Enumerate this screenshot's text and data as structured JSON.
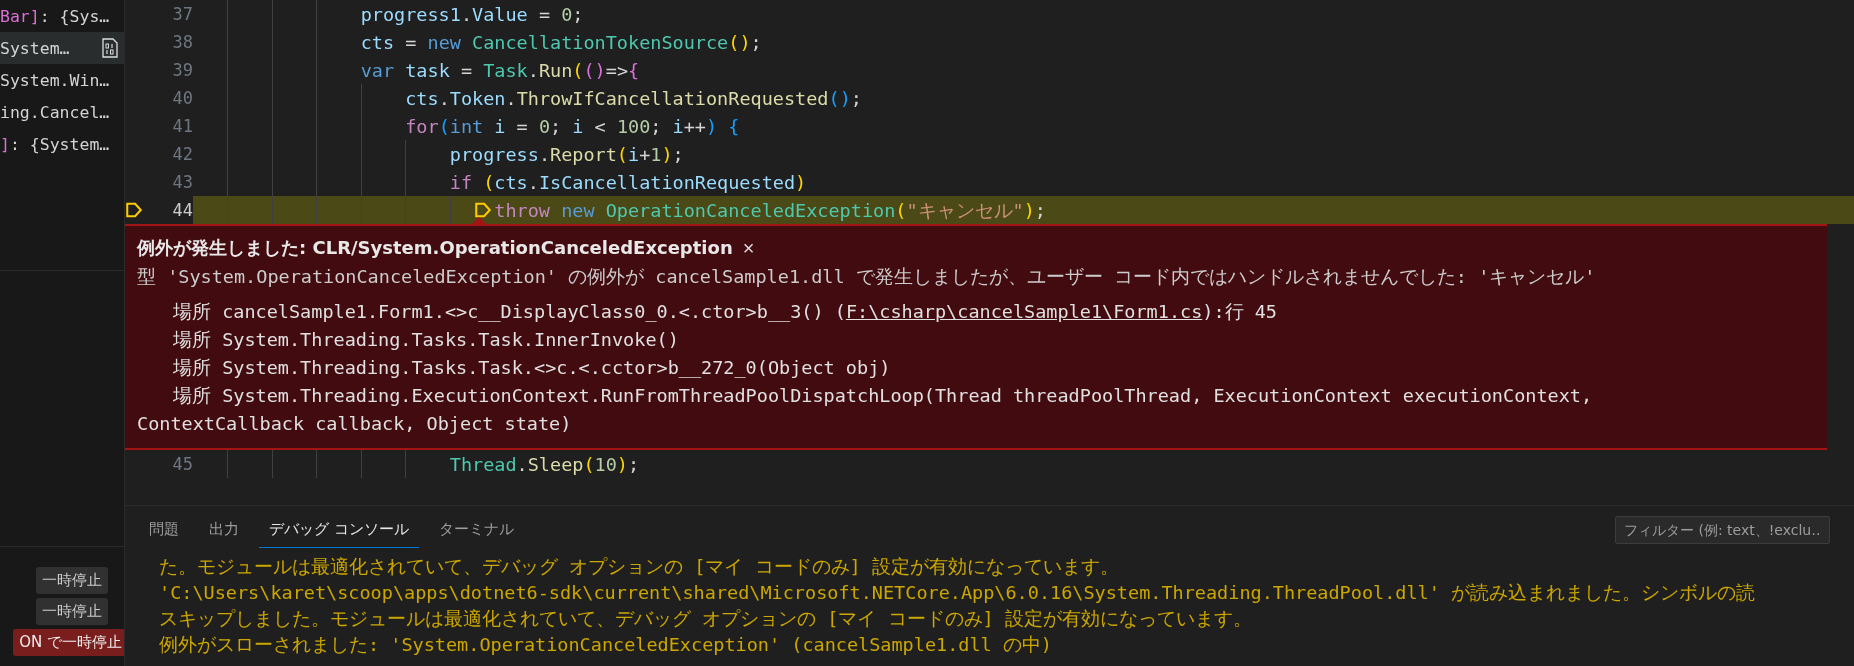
{
  "sidebar": {
    "variables": [
      {
        "parts": [
          {
            "kind": "bracket2",
            "t": "Bar]"
          },
          {
            "kind": "plain",
            "t": ": {Sys…"
          }
        ],
        "selected": false,
        "binary_icon": false
      },
      {
        "parts": [
          {
            "kind": "plain",
            "t": "System…"
          }
        ],
        "selected": true,
        "binary_icon": true
      },
      {
        "parts": [
          {
            "kind": "plain",
            "t": "System.Win…"
          }
        ],
        "selected": false,
        "binary_icon": false
      },
      {
        "parts": [
          {
            "kind": "plain",
            "t": "ing.Cancel…"
          }
        ],
        "selected": false,
        "binary_icon": false
      },
      {
        "parts": [
          {
            "kind": "bracket2",
            "t": "]"
          },
          {
            "kind": "plain",
            "t": ": {System…"
          }
        ],
        "selected": false,
        "binary_icon": false
      }
    ],
    "breakpoint_buttons": [
      {
        "label": "一時停止",
        "kind": "plain"
      },
      {
        "label": "一時停止",
        "kind": "plain"
      },
      {
        "label": "ON で一時停止",
        "kind": "alert"
      }
    ]
  },
  "editor": {
    "lines": [
      {
        "number": "37",
        "current": false,
        "tokens": [
          {
            "kind": "variable",
            "t": "            progress1"
          },
          {
            "kind": "plain",
            "t": "."
          },
          {
            "kind": "variable",
            "t": "Value"
          },
          {
            "kind": "plain",
            "t": " = "
          },
          {
            "kind": "number",
            "t": "0"
          },
          {
            "kind": "plain",
            "t": ";"
          }
        ]
      },
      {
        "number": "38",
        "current": false,
        "tokens": [
          {
            "kind": "variable",
            "t": "            cts"
          },
          {
            "kind": "plain",
            "t": " = "
          },
          {
            "kind": "keyword",
            "t": "new "
          },
          {
            "kind": "type",
            "t": "CancellationTokenSource"
          },
          {
            "kind": "bracket1",
            "t": "()"
          },
          {
            "kind": "plain",
            "t": ";"
          }
        ]
      },
      {
        "number": "39",
        "current": false,
        "tokens": [
          {
            "kind": "keyword",
            "t": "            var "
          },
          {
            "kind": "variable",
            "t": "task"
          },
          {
            "kind": "plain",
            "t": " = "
          },
          {
            "kind": "type",
            "t": "Task"
          },
          {
            "kind": "plain",
            "t": "."
          },
          {
            "kind": "function",
            "t": "Run"
          },
          {
            "kind": "bracket1",
            "t": "("
          },
          {
            "kind": "bracket2",
            "t": "()"
          },
          {
            "kind": "plain",
            "t": "=>"
          },
          {
            "kind": "bracket2",
            "t": "{"
          }
        ]
      },
      {
        "number": "40",
        "current": false,
        "tokens": [
          {
            "kind": "variable",
            "t": "                cts"
          },
          {
            "kind": "plain",
            "t": "."
          },
          {
            "kind": "variable",
            "t": "Token"
          },
          {
            "kind": "plain",
            "t": "."
          },
          {
            "kind": "function",
            "t": "ThrowIfCancellationRequested"
          },
          {
            "kind": "bracket3",
            "t": "()"
          },
          {
            "kind": "plain",
            "t": ";"
          }
        ]
      },
      {
        "number": "41",
        "current": false,
        "tokens": [
          {
            "kind": "control",
            "t": "                for"
          },
          {
            "kind": "bracket3",
            "t": "("
          },
          {
            "kind": "keyword",
            "t": "int "
          },
          {
            "kind": "variable",
            "t": "i"
          },
          {
            "kind": "plain",
            "t": " = "
          },
          {
            "kind": "number",
            "t": "0"
          },
          {
            "kind": "plain",
            "t": "; "
          },
          {
            "kind": "variable",
            "t": "i"
          },
          {
            "kind": "plain",
            "t": " < "
          },
          {
            "kind": "number",
            "t": "100"
          },
          {
            "kind": "plain",
            "t": "; "
          },
          {
            "kind": "variable",
            "t": "i"
          },
          {
            "kind": "plain",
            "t": "++"
          },
          {
            "kind": "bracket3",
            "t": ")"
          },
          {
            "kind": "bracket3",
            "t": " {"
          }
        ]
      },
      {
        "number": "42",
        "current": false,
        "tokens": [
          {
            "kind": "variable",
            "t": "                    progress"
          },
          {
            "kind": "plain",
            "t": "."
          },
          {
            "kind": "function",
            "t": "Report"
          },
          {
            "kind": "bracket1",
            "t": "("
          },
          {
            "kind": "variable",
            "t": "i"
          },
          {
            "kind": "plain",
            "t": "+"
          },
          {
            "kind": "number",
            "t": "1"
          },
          {
            "kind": "bracket1",
            "t": ")"
          },
          {
            "kind": "plain",
            "t": ";"
          }
        ]
      },
      {
        "number": "43",
        "current": false,
        "tokens": [
          {
            "kind": "control",
            "t": "                    if"
          },
          {
            "kind": "bracket1",
            "t": " ("
          },
          {
            "kind": "variable",
            "t": "cts"
          },
          {
            "kind": "plain",
            "t": "."
          },
          {
            "kind": "variable",
            "t": "IsCancellationRequested"
          },
          {
            "kind": "bracket1",
            "t": ")"
          }
        ]
      },
      {
        "number": "44",
        "current": true,
        "tokens": [
          {
            "kind": "control",
            "t": "                        throw "
          },
          {
            "kind": "keyword",
            "t": "new "
          },
          {
            "kind": "type",
            "t": "OperationCanceledException"
          },
          {
            "kind": "bracket1",
            "t": "("
          },
          {
            "kind": "string",
            "t": "\"キャンセル\""
          },
          {
            "kind": "bracket1",
            "t": ")"
          },
          {
            "kind": "plain",
            "t": ";"
          }
        ]
      }
    ],
    "exception": {
      "title": "例外が発生しました: CLR/System.OperationCanceledException",
      "close": "×",
      "message": "型 'System.OperationCanceledException' の例外が cancelSample1.dll で発生しましたが、ユーザー コード内ではハンドルされませんでした: 'キャンセル'",
      "frames": [
        {
          "label": "場所",
          "text": "cancelSample1.Form1.<>c__DisplayClass0_0.<.ctor>b__3() (",
          "link": "F:\\csharp\\cancelSample1\\Form1.cs",
          "suffix": "):行 45"
        },
        {
          "label": "場所",
          "text": "System.Threading.Tasks.Task.InnerInvoke()"
        },
        {
          "label": "場所",
          "text": "System.Threading.Tasks.Task.<>c.<.cctor>b__272_0(Object obj)"
        },
        {
          "label": "場所",
          "text": "System.Threading.ExecutionContext.RunFromThreadPoolDispatchLoop(Thread threadPoolThread, ExecutionContext executionContext, ContextCallback callback, Object state)"
        }
      ]
    },
    "lines_after": [
      {
        "number": "45",
        "current": false,
        "tokens": [
          {
            "kind": "type",
            "t": "                    Thread"
          },
          {
            "kind": "plain",
            "t": "."
          },
          {
            "kind": "function",
            "t": "Sleep"
          },
          {
            "kind": "bracket1",
            "t": "("
          },
          {
            "kind": "number",
            "t": "10"
          },
          {
            "kind": "bracket1",
            "t": ")"
          },
          {
            "kind": "plain",
            "t": ";"
          }
        ]
      }
    ]
  },
  "panel": {
    "tabs": [
      {
        "label": "問題",
        "selected": false
      },
      {
        "label": "出力",
        "selected": false
      },
      {
        "label": "デバッグ コンソール",
        "selected": true
      },
      {
        "label": "ターミナル",
        "selected": false
      }
    ],
    "filter": {
      "placeholder": "フィルター (例: text、!exclu…"
    },
    "console": [
      "た。モジュールは最適化されていて、デバッグ オプションの [マイ コードのみ] 設定が有効になっています。",
      "'C:\\Users\\karet\\scoop\\apps\\dotnet6-sdk\\current\\shared\\Microsoft.NETCore.App\\6.0.16\\System.Threading.ThreadPool.dll' が読み込まれました。シンボルの読",
      "スキップしました。モジュールは最適化されていて、デバッグ オプションの [マイ コードのみ] 設定が有効になっています。",
      "例外がスローされました: 'System.OperationCanceledException' (cancelSample1.dll の中)"
    ]
  }
}
